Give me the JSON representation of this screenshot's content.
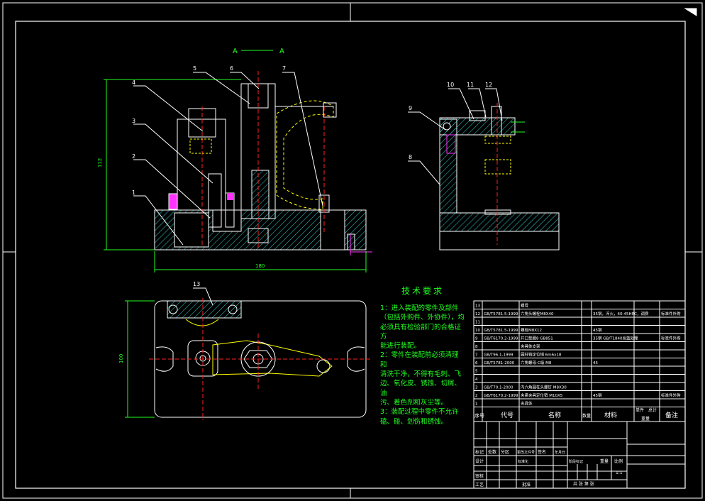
{
  "section_label": {
    "left": "A",
    "right": "A"
  },
  "balloons": [
    "1",
    "2",
    "3",
    "4",
    "5",
    "6",
    "7",
    "8",
    "9",
    "10",
    "11",
    "12",
    "13"
  ],
  "dimensions": {
    "height": "112",
    "width_front": "180",
    "width_top": "100"
  },
  "technical_requirements": {
    "title": "技术要求",
    "lines": [
      "1：进入装配的零件及部件",
      "（包括外购件、外协件），均",
      "必须具有检验部门的合格证方",
      "能进行装配。",
      "2：零件在装配前必须清理和",
      "清洗干净，不得有毛刺、飞",
      "边、氧化皮、锈蚀、切屑、油",
      "污、着色剂和灰尘等。",
      "3：装配过程中零件不允许",
      "磕、碰、划伤和锈蚀。"
    ]
  },
  "bom": {
    "header": {
      "seq": "序号",
      "code": "代号",
      "name": "名称",
      "qty": "数量",
      "material": "材料",
      "unit": "单件",
      "total": "总计",
      "weight": "重量",
      "remark": "备注"
    },
    "rows": [
      {
        "seq": "13",
        "code": "",
        "name": "螺母",
        "material": "",
        "remark": ""
      },
      {
        "seq": "12",
        "code": "GB/T5781.5-1999",
        "name": "六角头螺栓M8X40",
        "material": "35钢，淬火，40-45HRC，调质",
        "remark": "标准件外购"
      },
      {
        "seq": "11",
        "code": "",
        "name": "",
        "material": "",
        "remark": ""
      },
      {
        "seq": "10",
        "code": "GB/T5781.5-1999",
        "name": "螺栓M8X12",
        "material": "45钢",
        "remark": ""
      },
      {
        "seq": "9",
        "code": "GB/T6170.2-1999",
        "name": "开口垫圈8 GB851",
        "material": "35钢 GB/T1840发蓝处理",
        "remark": "标准件外购"
      },
      {
        "seq": "8",
        "code": "",
        "name": "夹具体支架",
        "material": "",
        "remark": ""
      },
      {
        "seq": "7",
        "code": "GB/T96.1-1999",
        "name": "圆柱销定位销 6m6x18",
        "material": "",
        "remark": ""
      },
      {
        "seq": "6",
        "code": "GB/T5781-2000",
        "name": "六角螺母-C级 M8",
        "material": "45",
        "remark": ""
      },
      {
        "seq": "5",
        "code": "",
        "name": "",
        "material": "",
        "remark": ""
      },
      {
        "seq": "4",
        "code": "",
        "name": "",
        "material": "",
        "remark": ""
      },
      {
        "seq": "3",
        "code": "GB/T70.1-2000",
        "name": "内六角圆柱头螺钉 M8X30",
        "material": "",
        "remark": ""
      },
      {
        "seq": "2",
        "code": "GB/T6170.2-1999",
        "name": "夹紧夹具定位销 M10X5",
        "material": "45钢",
        "remark": "标准件外购"
      },
      {
        "seq": "1",
        "code": "",
        "name": "夹具体",
        "material": "",
        "remark": ""
      }
    ],
    "weight_sub": "重量"
  },
  "title_block": {
    "cells": [
      "标记",
      "处数",
      "分区",
      "更改文件号",
      "签名",
      "年月日",
      "设计",
      "标准化",
      "阶段标记",
      "重量",
      "比例",
      "审核",
      "工艺",
      "批准",
      "共 张 第 张"
    ],
    "scale": "1:1"
  },
  "colors": {
    "line": "#ffffff",
    "dim": "#22ff22",
    "leader": "#ffff00",
    "center": "#ff2020",
    "hatch": "#33cccc",
    "accent": "#ff33ff"
  }
}
